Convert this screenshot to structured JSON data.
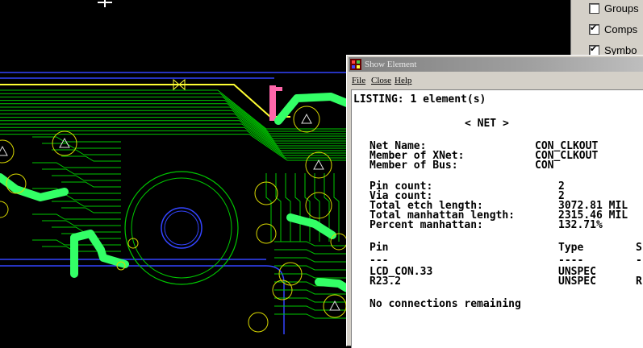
{
  "side_panel": {
    "items": [
      {
        "label": "Groups",
        "checked": false
      },
      {
        "label": "Comps",
        "checked": true
      },
      {
        "label": "Symbo",
        "checked": true
      }
    ]
  },
  "show_element": {
    "title": "Show Element",
    "menu": [
      "File",
      "Close",
      "Help"
    ],
    "listing_line": "LISTING: 1 element(s)",
    "section_header": "< NET >",
    "net_name_label": "Net Name:",
    "net_name_value": "CON_CLKOUT",
    "xnet_label": "Member of XNet:",
    "xnet_value": "CON_CLKOUT",
    "bus_label": "Member of Bus:",
    "bus_value": "CON",
    "pin_count_label": "Pin count:",
    "pin_count_value": "2",
    "via_count_label": "Via count:",
    "via_count_value": "2",
    "etch_label": "Total etch length:",
    "etch_value": "3072.81 MIL",
    "manhattan_label": "Total manhattan length:",
    "manhattan_value": "2315.46 MIL",
    "percent_label": "Percent manhattan:",
    "percent_value": "132.71%",
    "col_pin": "Pin",
    "col_type": "Type",
    "col_s": "S",
    "dash_pin": "---",
    "dash_type": "----",
    "dash_s": "-",
    "rows": [
      {
        "pin": "LCD_CON.33",
        "type": "UNSPEC",
        "s": ""
      },
      {
        "pin": "R23.2",
        "type": "UNSPEC",
        "s": "R"
      }
    ],
    "footer": "No connections remaining"
  },
  "colors": {
    "trace": "#00c800",
    "bright_trace": "#33ff66",
    "highlight": "#ffff33",
    "board_edge": "#3344ff",
    "pad_outline": "#d8d800",
    "pink": "#ff66aa",
    "panel": "#d4d0c8"
  }
}
